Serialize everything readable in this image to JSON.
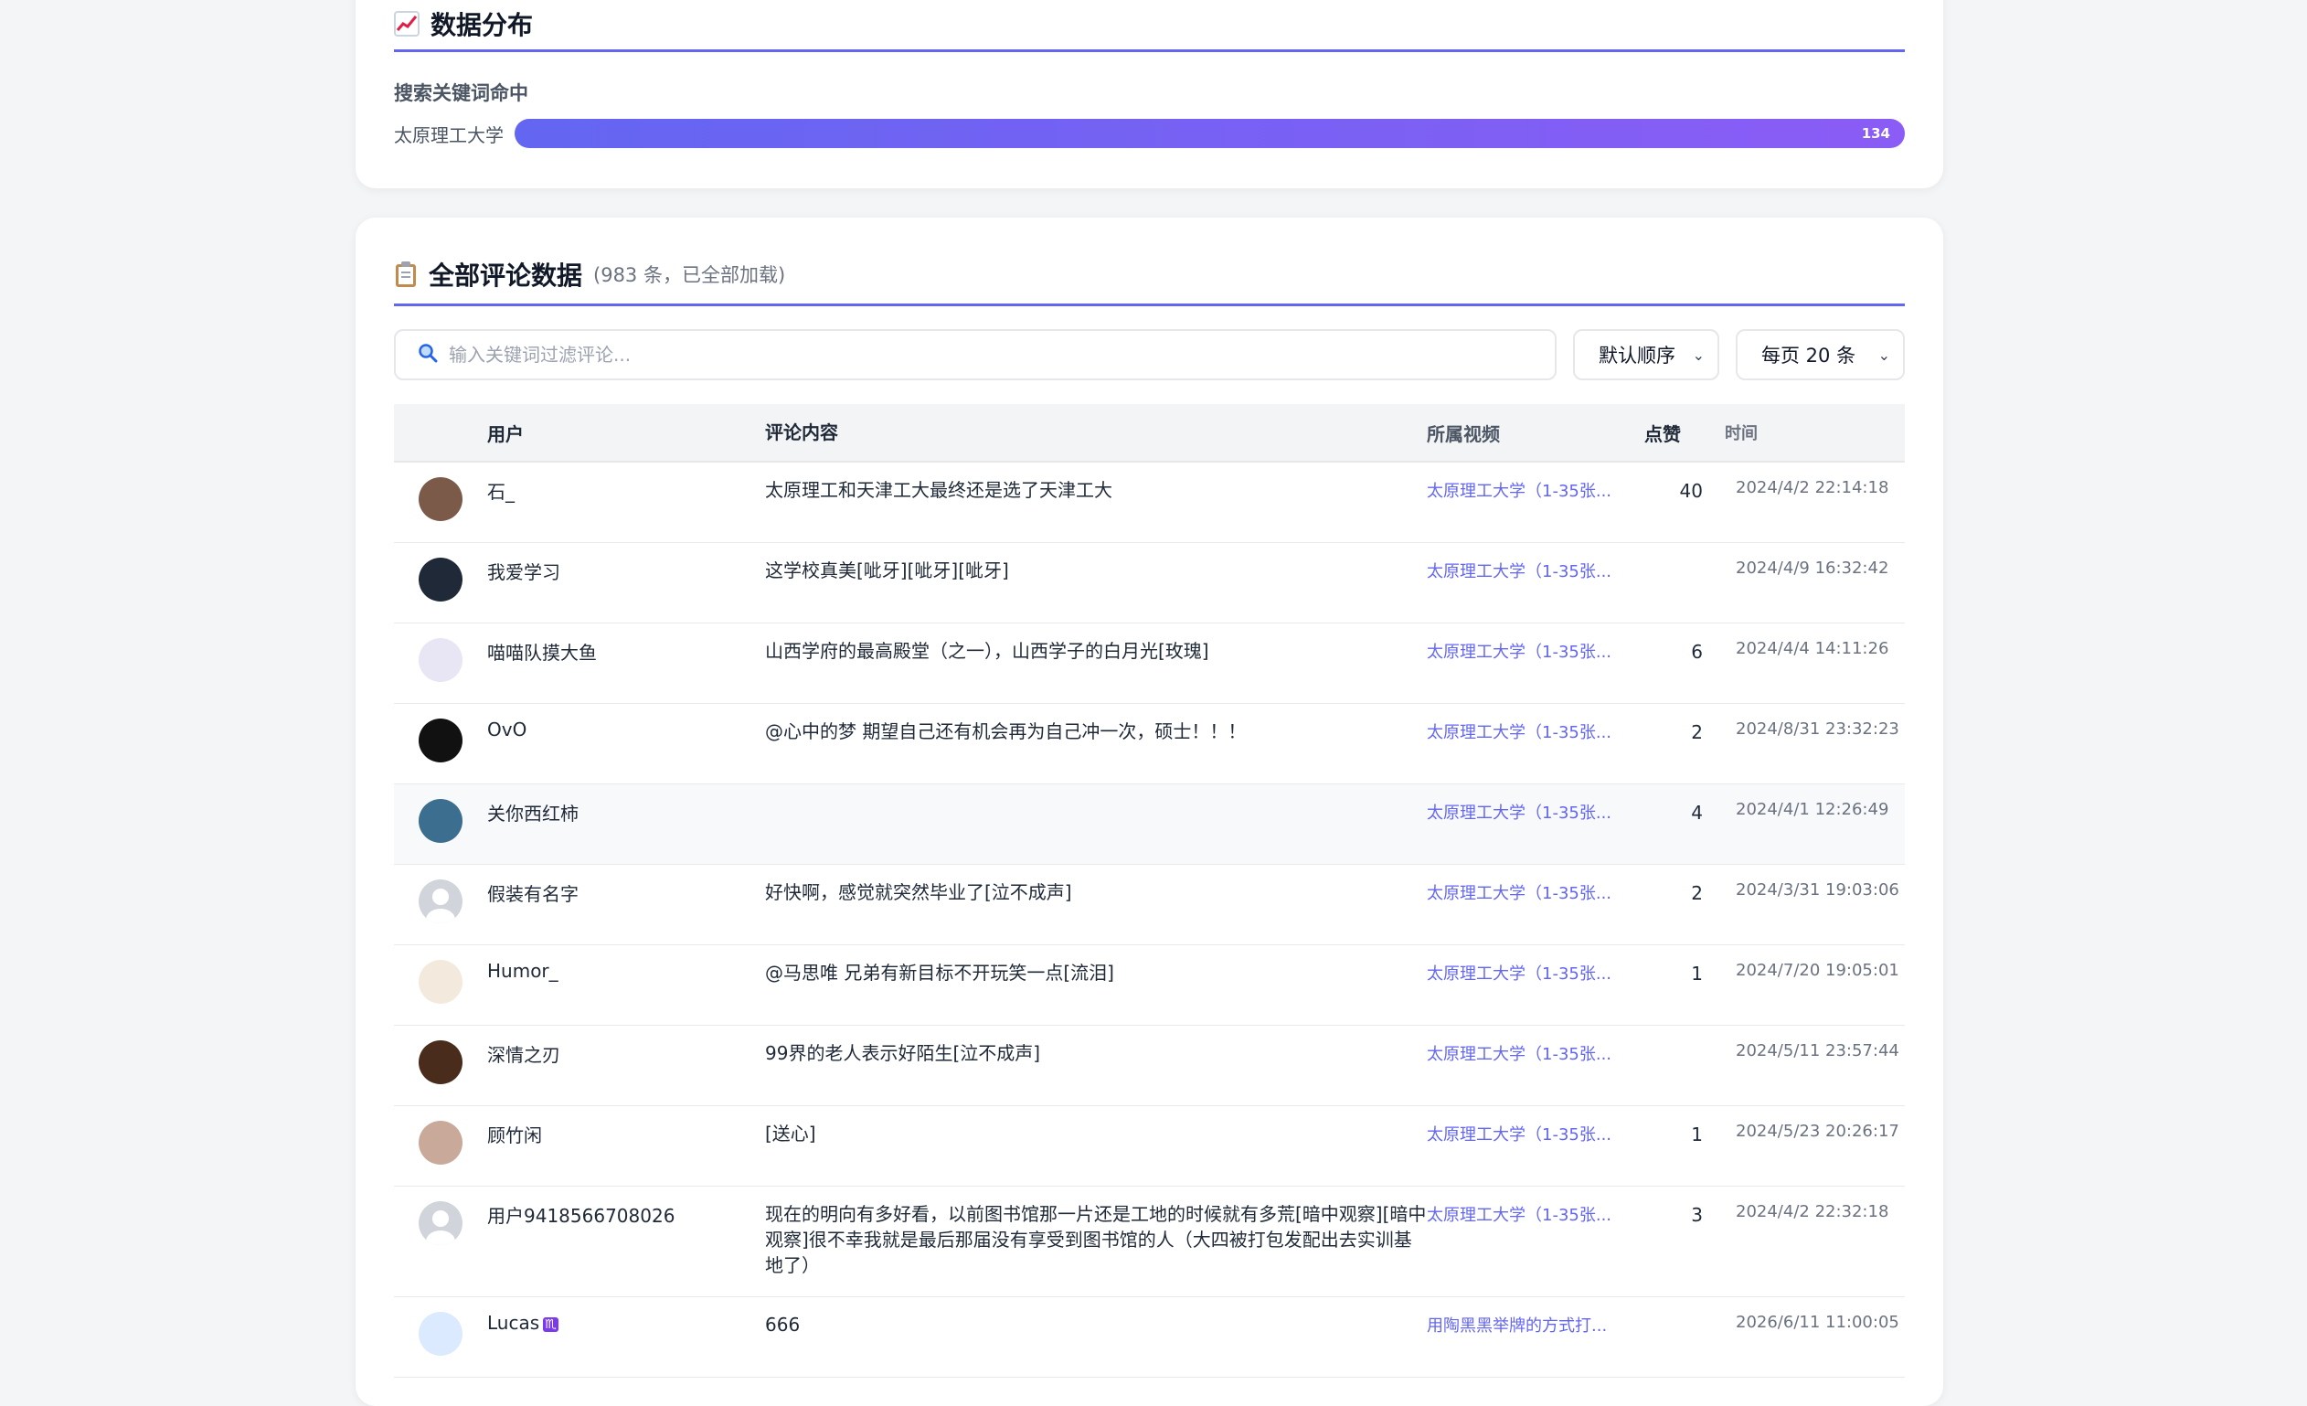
{
  "distribution": {
    "icon": "chart-increasing-icon",
    "title": "数据分布",
    "section_label": "搜索关键词命中",
    "bars": [
      {
        "name": "太原理工大学",
        "value": "134",
        "fraction": 1.0
      }
    ]
  },
  "comments": {
    "icon": "clipboard-icon",
    "title": "全部评论数据",
    "subtitle": "(983 条，已全部加载)",
    "search_placeholder": "输入关键词过滤评论...",
    "order_select": "默认顺序",
    "page_size_select": "每页 20 条",
    "columns": [
      "用户",
      "评论内容",
      "所属视频",
      "点赞",
      "时间"
    ],
    "rows": [
      {
        "user": "石_",
        "text": "太原理工和天津工大最终还是选了天津工大",
        "video": "太原理工大学（1-35张...",
        "likes": "40",
        "time": "2024/4/2 22:14:18",
        "avatar_color": "#7c5a4a",
        "avatar_icon": "landscape-avatar"
      },
      {
        "user": "我爱学习",
        "text": "这学校真美[呲牙][呲牙][呲牙]",
        "video": "太原理工大学（1-35张...",
        "likes": "",
        "time": "2024/4/9 16:32:42",
        "avatar_color": "#1f2937",
        "avatar_icon": "dark-avatar"
      },
      {
        "user": "喵喵队摸大鱼",
        "text": "山西学府的最高殿堂（之一），山西学子的白月光[玫瑰]",
        "video": "太原理工大学（1-35张...",
        "likes": "6",
        "time": "2024/4/4 14:11:26",
        "avatar_color": "#e8e6f4",
        "avatar_icon": "cat-avatar"
      },
      {
        "user": "OvO",
        "text": "@心中的梦 期望自己还有机会再为自己冲一次，硕士！！！",
        "video": "太原理工大学（1-35张...",
        "likes": "2",
        "time": "2024/8/31 23:32:23",
        "avatar_color": "#111111",
        "avatar_icon": "night-avatar"
      },
      {
        "user": "关你西红柿",
        "text": "",
        "video": "太原理工大学（1-35张...",
        "likes": "4",
        "time": "2024/4/1 12:26:49",
        "avatar_color": "#3b6e8f",
        "avatar_icon": "bird-avatar"
      },
      {
        "user": "假装有名字",
        "text": "好快啊，感觉就突然毕业了[泣不成声]",
        "video": "太原理工大学（1-35张...",
        "likes": "2",
        "time": "2024/3/31 19:03:06",
        "avatar_color": "#d1d5db",
        "avatar_icon": "default-user-avatar"
      },
      {
        "user": "Humor_",
        "text": "@马思唯 兄弟有新目标不开玩笑一点[流泪]",
        "video": "太原理工大学（1-35张...",
        "likes": "1",
        "time": "2024/7/20 19:05:01",
        "avatar_color": "#f3e9dc",
        "avatar_icon": "cartoon-avatar"
      },
      {
        "user": "深情之刃",
        "text": "99界的老人表示好陌生[泣不成声]",
        "video": "太原理工大学（1-35张...",
        "likes": "",
        "time": "2024/5/11 23:57:44",
        "avatar_color": "#4a2c1d",
        "avatar_icon": "figure-avatar"
      },
      {
        "user": "顾竹闲",
        "text": "[送心]",
        "video": "太原理工大学（1-35张...",
        "likes": "1",
        "time": "2024/5/23 20:26:17",
        "avatar_color": "#c9a99a",
        "avatar_icon": "person-avatar"
      },
      {
        "user": "用户9418566708026",
        "text": "现在的明向有多好看，以前图书馆那一片还是工地的时候就有多荒[暗中观察][暗中观察]很不幸我就是最后那届没有享受到图书馆的人（大四被打包发配出去实训基地了）",
        "video": "太原理工大学（1-35张...",
        "likes": "3",
        "time": "2024/4/2 22:32:18",
        "avatar_color": "#d1d5db",
        "avatar_icon": "default-user-avatar"
      },
      {
        "user": "Lucas",
        "badge": "♏",
        "text": "666",
        "video": "用陶黑黑举牌的方式打...",
        "likes": "",
        "time": "2026/6/11 11:00:05",
        "avatar_color": "#dbeafe",
        "avatar_icon": "anime-avatar"
      }
    ]
  }
}
